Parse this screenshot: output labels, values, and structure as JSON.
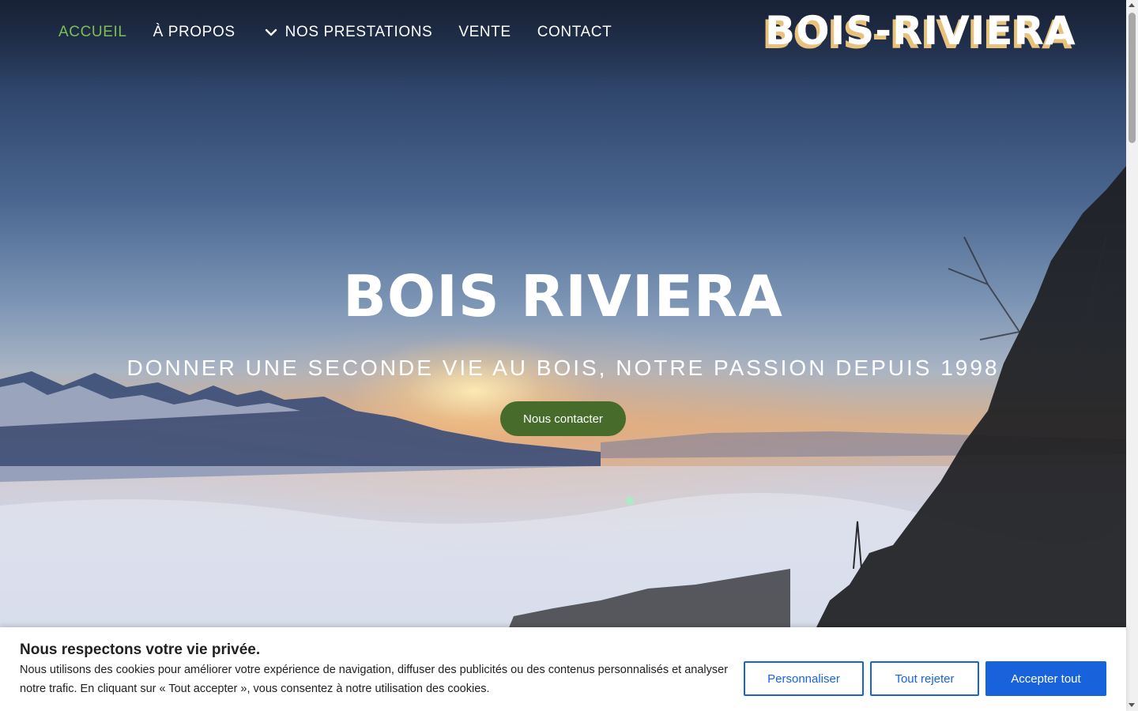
{
  "nav": {
    "items": [
      {
        "label": "ACCUEIL"
      },
      {
        "label": "À PROPOS"
      },
      {
        "label": "NOS PRESTATIONS",
        "icon": "chevron-down-icon"
      },
      {
        "label": "VENTE"
      },
      {
        "label": "CONTACT"
      }
    ],
    "active_color": "#7bbf54"
  },
  "logo": {
    "text": "BOIS-RIVIERA"
  },
  "hero": {
    "title": "BOIS RIVIERA",
    "subtitle": "DONNER UNE SECONDE VIE AU BOIS, NOTRE PASSION DEPUIS 1998",
    "cta_label": "Nous contacter",
    "cta_color": "#466b2a"
  },
  "cookie": {
    "title": "Nous respectons votre vie privée.",
    "text": "Nous utilisons des cookies pour améliorer votre expérience de navigation, diffuser des publicités ou des contenus personnalisés et analyser notre trafic. En cliquant sur « Tout accepter », vous consentez à notre utilisation des cookies.",
    "customize_label": "Personnaliser",
    "reject_label": "Tout rejeter",
    "accept_label": "Accepter tout",
    "accent_color": "#1863dc"
  }
}
